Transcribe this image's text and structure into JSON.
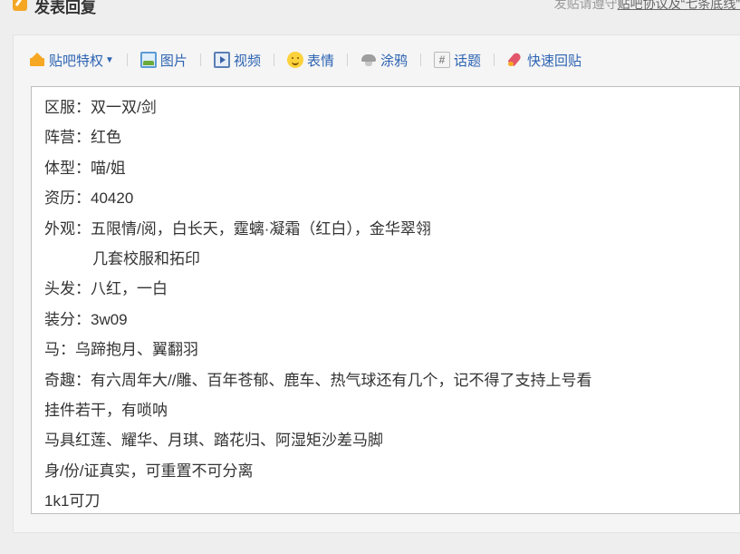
{
  "header": {
    "title": "发表回复",
    "notice_prefix": "发贴请遵守",
    "notice_link": "贴吧协议及“七条底线”"
  },
  "toolbar": {
    "items": [
      {
        "label": "贴吧特权",
        "icon": "crown-icon",
        "has_dropdown": true
      },
      {
        "label": "图片",
        "icon": "picture-icon"
      },
      {
        "label": "视频",
        "icon": "video-icon"
      },
      {
        "label": "表情",
        "icon": "smiley-icon"
      },
      {
        "label": "涂鸦",
        "icon": "brush-icon"
      },
      {
        "label": "话题",
        "icon": "hashtag-icon"
      },
      {
        "label": "快速回贴",
        "icon": "rocket-icon"
      }
    ]
  },
  "editor": {
    "lines": [
      "区服：双一双/剑",
      "阵营：红色",
      "体型：喵/姐",
      "资历：40420",
      "外观：五限情/阅，白长天，霆螭·凝霜（红白），金华翠翎",
      "几套校服和拓印",
      "头发：八红，一白",
      "装分：3w09",
      "马：乌蹄抱月、翼翻羽",
      "奇趣：有六周年大//雕、百年苍郁、鹿车、热气球还有几个，记不得了支持上号看",
      "挂件若干，有唢呐",
      "马具红莲、耀华、月琪、踏花归、阿湿矩沙差马脚",
      "身/份/证真实，可重置不可分离",
      "1k1可刀"
    ]
  },
  "colors": {
    "link": "#2d64b3",
    "page_bg": "#eeeeee",
    "panel_bg": "#f5f5f5",
    "accent_icon": "#f5a623"
  }
}
